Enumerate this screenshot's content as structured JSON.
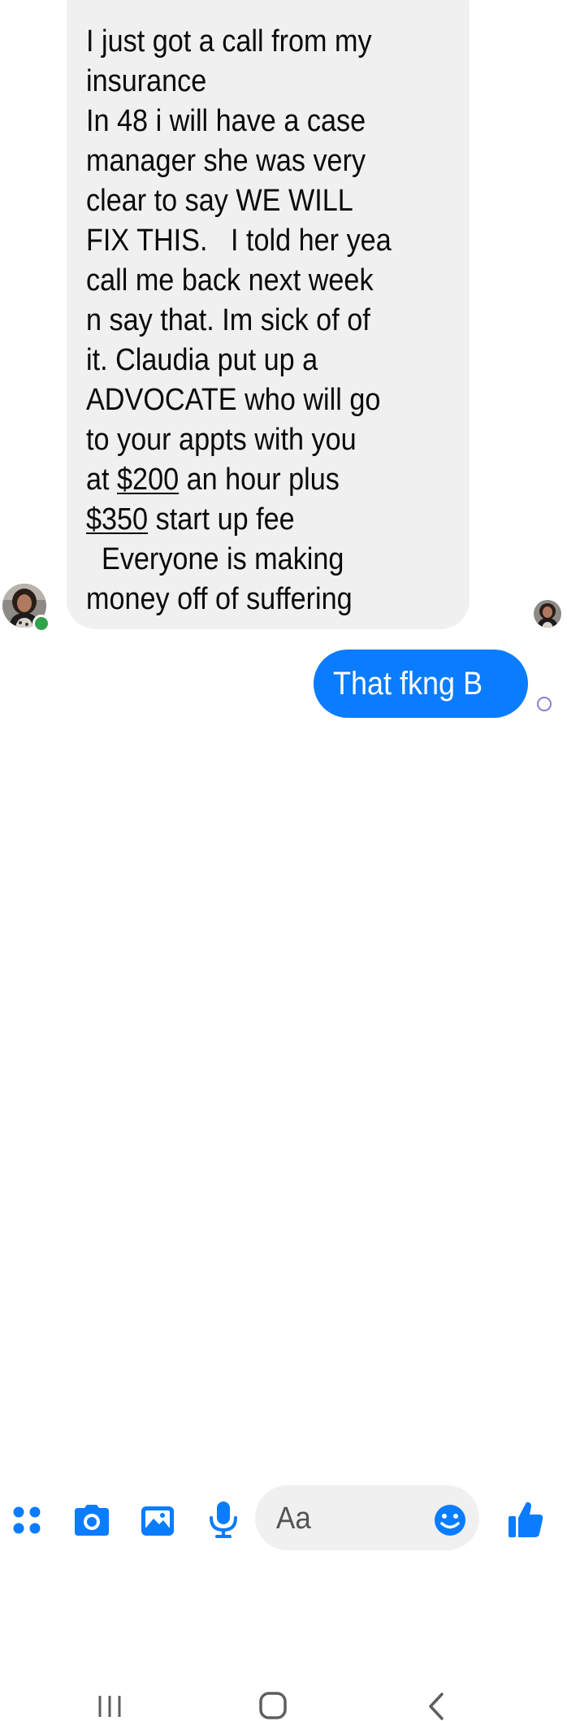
{
  "conversation": {
    "incoming_message": {
      "lines": [
        "I just got a call from my",
        "insurance",
        "In 48 i will have a case",
        "manager she was very",
        "clear to say WE WILL",
        "FIX THIS.   I told her yea",
        "call me back next week",
        "n say that. Im sick of of",
        "it. Claudia put up a",
        "ADVOCATE who will go",
        "to your appts with you"
      ],
      "line_12_prefix": "at ",
      "price_hourly": "$200",
      "line_12_suffix": " an hour plus",
      "price_startup": "$350",
      "line_13_suffix": " start up fee",
      "line_14": "  Everyone is making",
      "line_15": "money off of suffering"
    },
    "outgoing_message": {
      "text": "That fkng B"
    },
    "sender_online": true
  },
  "composer": {
    "input_placeholder": "Aa",
    "icons": [
      "more-actions-icon",
      "camera-icon",
      "gallery-icon",
      "microphone-icon",
      "emoji-icon",
      "thumbs-up-icon"
    ]
  },
  "nav_bar": {
    "icons": [
      "recent-apps-icon",
      "home-icon",
      "back-icon"
    ]
  },
  "colors": {
    "accent": "#0a7cff",
    "incoming_bubble": "#f0f0f0",
    "online": "#31a24c",
    "sent_status": "#8a7fd4"
  }
}
